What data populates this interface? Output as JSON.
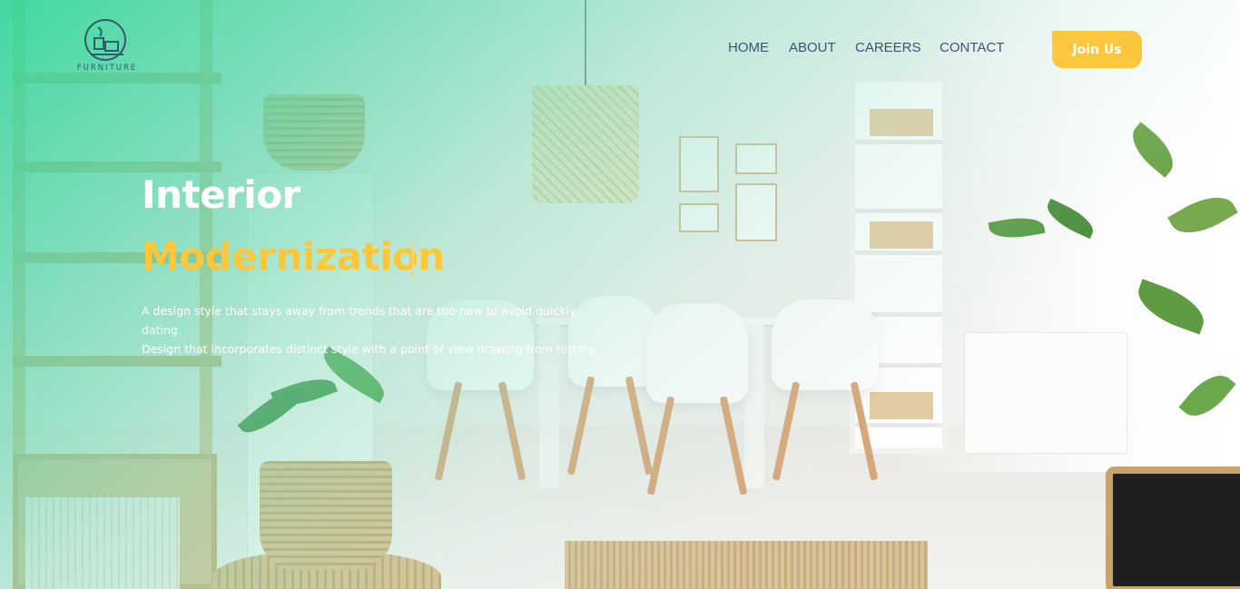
{
  "brand": {
    "logo_icon": "furniture-logo-icon",
    "name": "FURNITURE"
  },
  "nav": {
    "items": [
      {
        "label": "HOME"
      },
      {
        "label": "ABOUT"
      },
      {
        "label": "CAREERS"
      },
      {
        "label": "CONTACT"
      }
    ]
  },
  "cta": {
    "label": "Join Us"
  },
  "hero": {
    "title_line_1": "Interior",
    "title_line_2": "Modernization",
    "description_line_1": "A design style that stays away from trends that are too now to avoid quickly dating.",
    "description_line_2": "Design that incorporates distinct style with a point of view drawing from history."
  },
  "colors": {
    "accent_yellow": "#fcc73c",
    "overlay_green": "#34d698",
    "nav_text": "#43507a",
    "hero_text": "#ffffff"
  }
}
